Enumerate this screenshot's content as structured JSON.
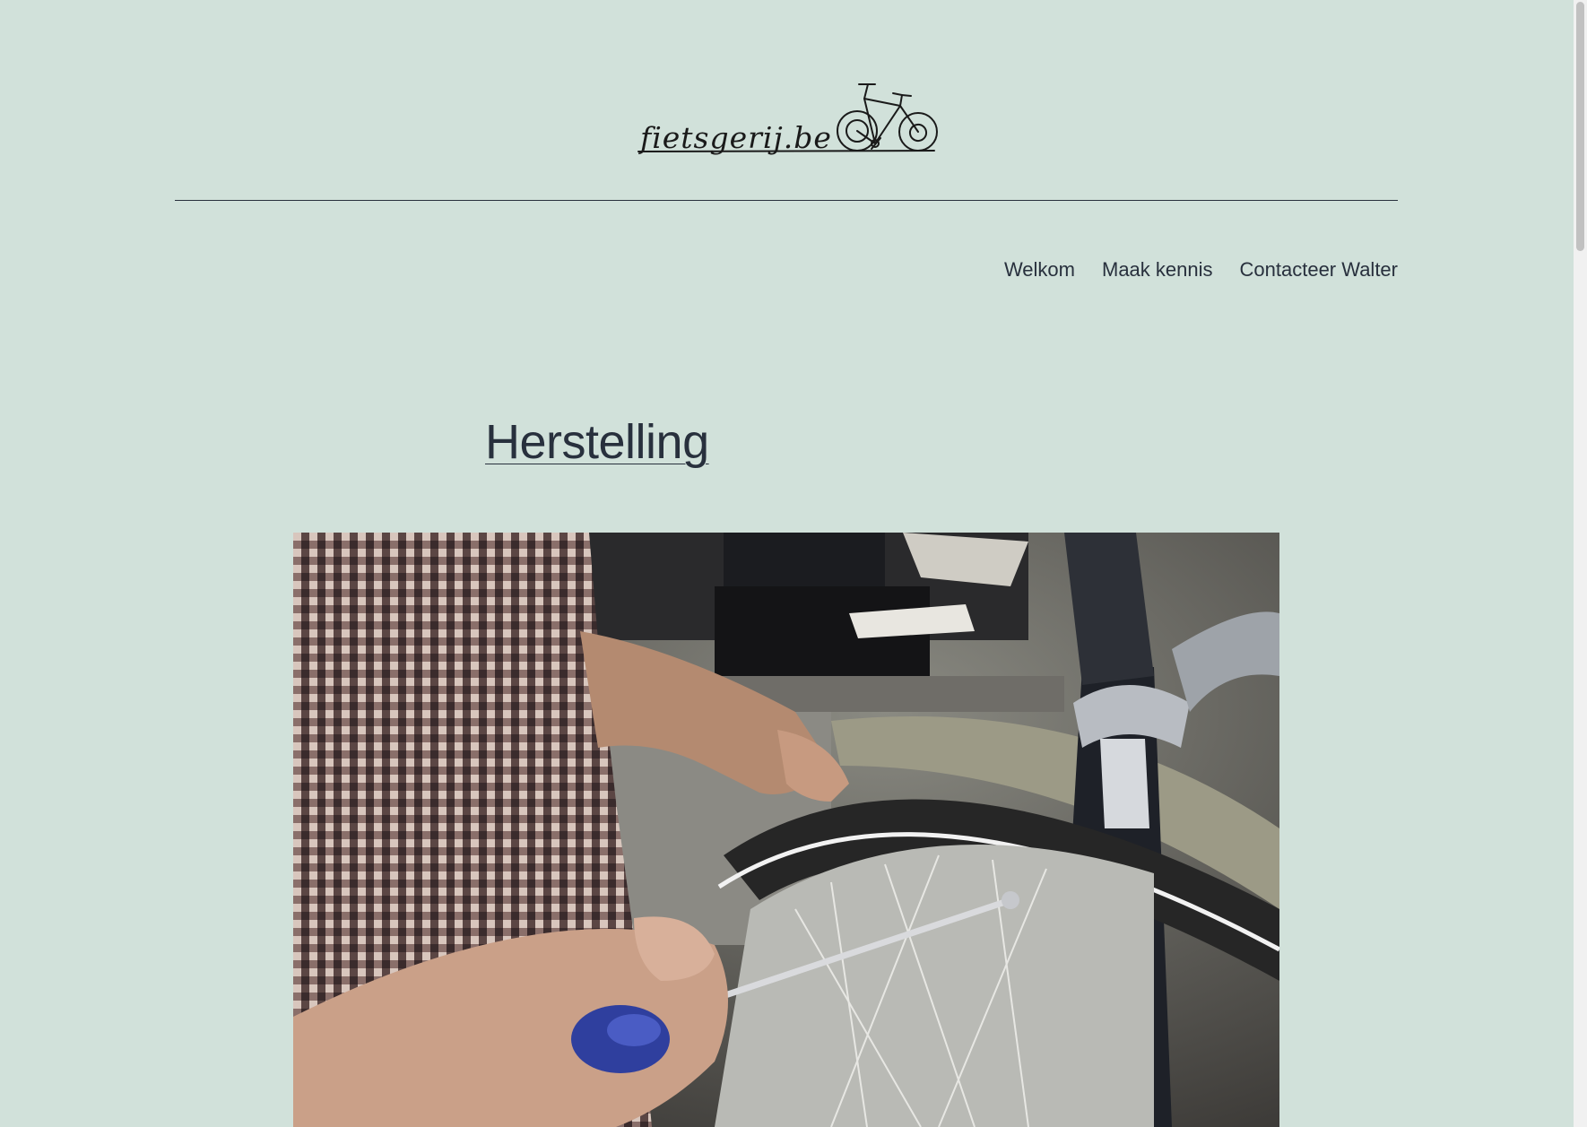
{
  "site": {
    "logo_text": "fietsgerij.be"
  },
  "nav": {
    "items": [
      {
        "label": "Welkom"
      },
      {
        "label": "Maak kennis"
      },
      {
        "label": "Contacteer Walter"
      }
    ]
  },
  "post": {
    "title": "Herstelling"
  },
  "colors": {
    "background": "#d1e1da",
    "text": "#28303d"
  }
}
